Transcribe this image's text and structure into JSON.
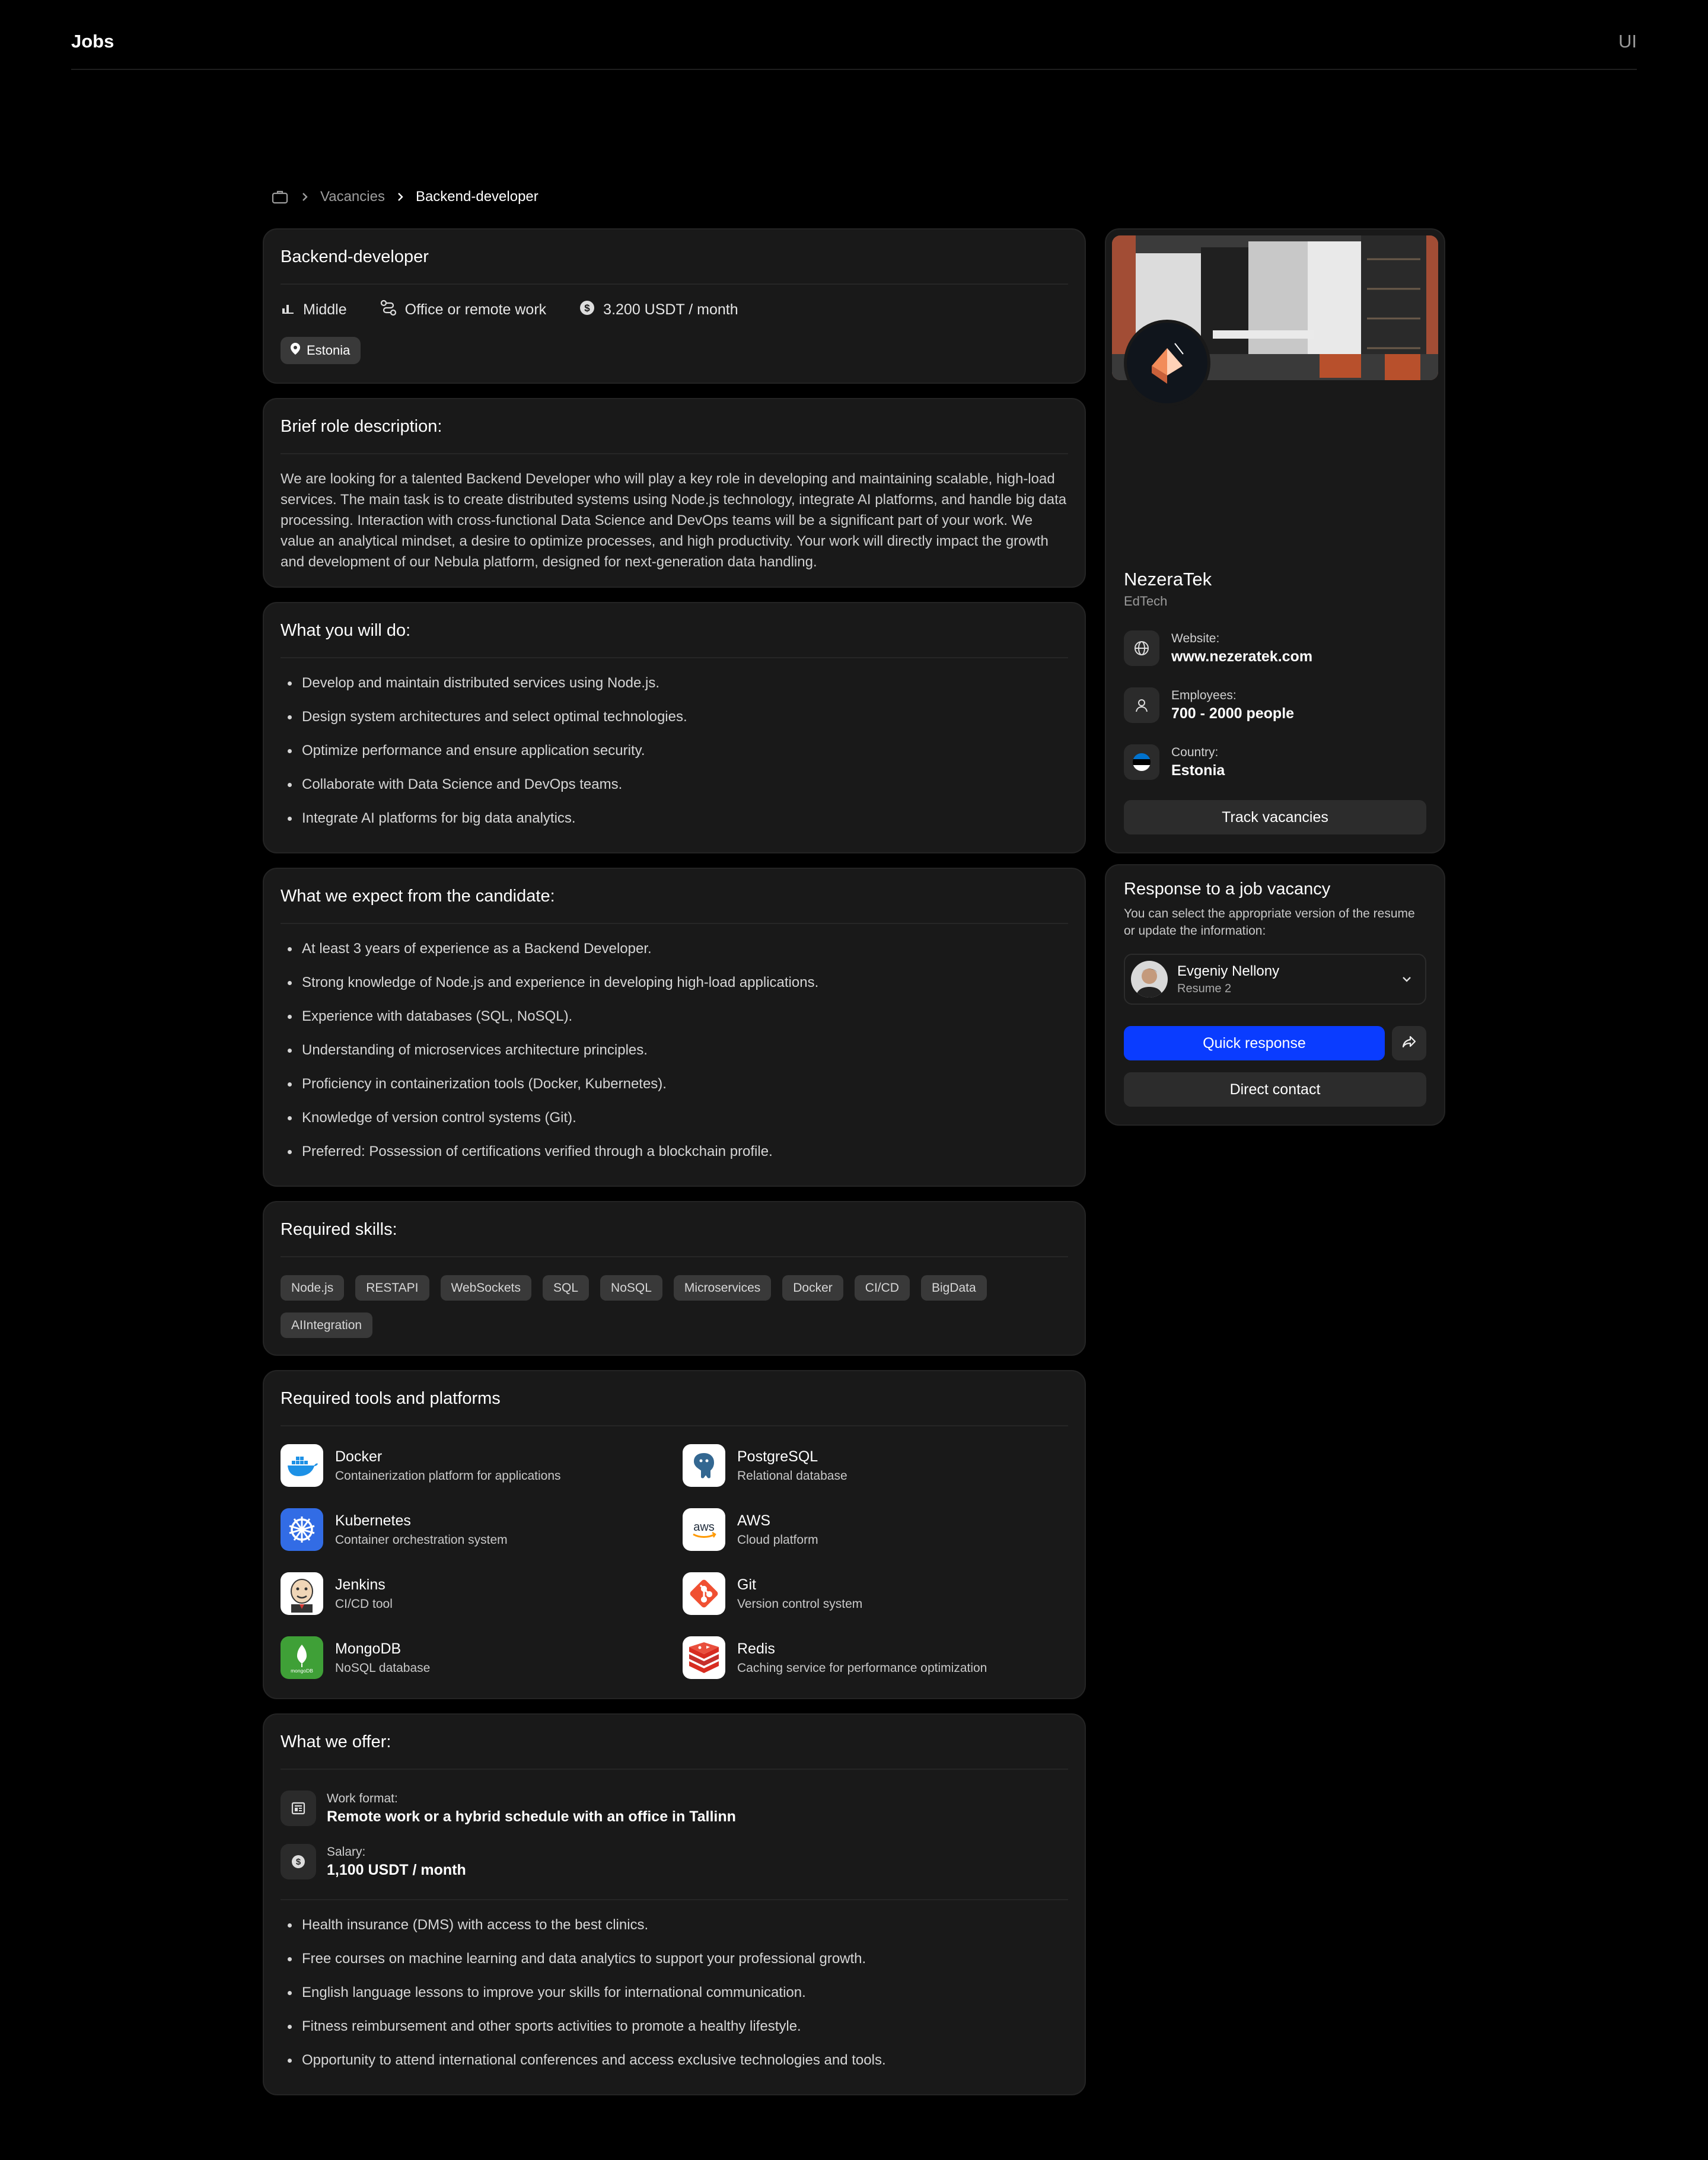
{
  "header": {
    "brand": "Jobs",
    "right_label": "UI"
  },
  "breadcrumb": {
    "icon": "briefcase-icon",
    "items": [
      "Vacancies",
      "Backend-developer"
    ]
  },
  "job": {
    "title": "Backend-developer",
    "level": "Middle",
    "work_type": "Office or remote work",
    "salary": "3.200 USDT / month",
    "location": "Estonia"
  },
  "brief": {
    "title": "Brief role description:",
    "text": "We are looking for a talented Backend Developer who will play a key role in developing and maintaining scalable, high-load services. The main task is to create distributed systems using Node.js technology, integrate AI platforms, and handle big data processing. Interaction with cross-functional Data Science and DevOps teams will be a significant part of your work. We value an analytical mindset, a desire to optimize processes, and high productivity. Your work will directly impact the growth and development of our Nebula platform, designed for next-generation data handling."
  },
  "duties": {
    "title": "What you will do:",
    "items": [
      "Develop and maintain distributed services using Node.js.",
      "Design system architectures and select optimal technologies.",
      "Optimize performance and ensure application security.",
      "Collaborate with Data Science and DevOps teams.",
      "Integrate AI platforms for big data analytics."
    ]
  },
  "expect": {
    "title": "What we expect from the candidate:",
    "items": [
      "At least 3 years of experience as a Backend Developer.",
      "Strong knowledge of Node.js and experience in developing high-load applications.",
      "Experience with databases (SQL, NoSQL).",
      "Understanding of microservices architecture principles.",
      "Proficiency in containerization tools (Docker, Kubernetes).",
      "Knowledge of version control systems (Git).",
      "Preferred: Possession of certifications verified through a blockchain profile."
    ]
  },
  "skills": {
    "title": "Required skills:",
    "items": [
      "Node.js",
      "RESTAPI",
      "WebSockets",
      "SQL",
      "NoSQL",
      "Microservices",
      "Docker",
      "CI/CD",
      "BigData",
      "AIIntegration"
    ]
  },
  "tools": {
    "title": "Required tools and platforms",
    "items": [
      {
        "name": "Docker",
        "desc": "Containerization platform for applications",
        "icon": "docker-logo"
      },
      {
        "name": "PostgreSQL",
        "desc": "Relational database",
        "icon": "postgresql-logo"
      },
      {
        "name": "Kubernetes",
        "desc": "Container orchestration system",
        "icon": "kubernetes-logo"
      },
      {
        "name": "AWS",
        "desc": "Cloud platform",
        "icon": "aws-logo"
      },
      {
        "name": "Jenkins",
        "desc": "CI/CD tool",
        "icon": "jenkins-logo"
      },
      {
        "name": "Git",
        "desc": "Version control system",
        "icon": "git-logo"
      },
      {
        "name": "MongoDB",
        "desc": "NoSQL database",
        "icon": "mongodb-logo"
      },
      {
        "name": "Redis",
        "desc": "Caching service for performance optimization",
        "icon": "redis-logo"
      }
    ]
  },
  "offer": {
    "title": "What we offer:",
    "work_format_label": "Work format:",
    "work_format": "Remote work or a hybrid schedule with an office in Tallinn",
    "salary_label": "Salary:",
    "salary": "1,100 USDT / month",
    "items": [
      "Health insurance (DMS) with access to the best clinics.",
      "Free courses on machine learning and data analytics to support your professional growth.",
      "English language lessons to improve your skills for international communication.",
      "Fitness reimbursement and other sports activities to promote a healthy lifestyle.",
      "Opportunity to attend international conferences and access exclusive technologies and tools."
    ]
  },
  "company": {
    "name": "NezeraTek",
    "category": "EdTech",
    "website_label": "Website:",
    "website": "www.nezeratek.com",
    "employees_label": "Employees:",
    "employees": "700 - 2000 people",
    "country_label": "Country:",
    "country": "Estonia",
    "track_button": "Track vacancies"
  },
  "response": {
    "title": "Response to a job vacancy",
    "subtitle": "You can select the appropriate version of the resume or update the information:",
    "resume_name": "Evgeniy Nellony",
    "resume_version": "Resume 2",
    "quick_button": "Quick response",
    "direct_button": "Direct contact"
  },
  "colors": {
    "background": "#000000",
    "card": "#191919",
    "accent": "#0a3cff",
    "chip": "#393939"
  }
}
